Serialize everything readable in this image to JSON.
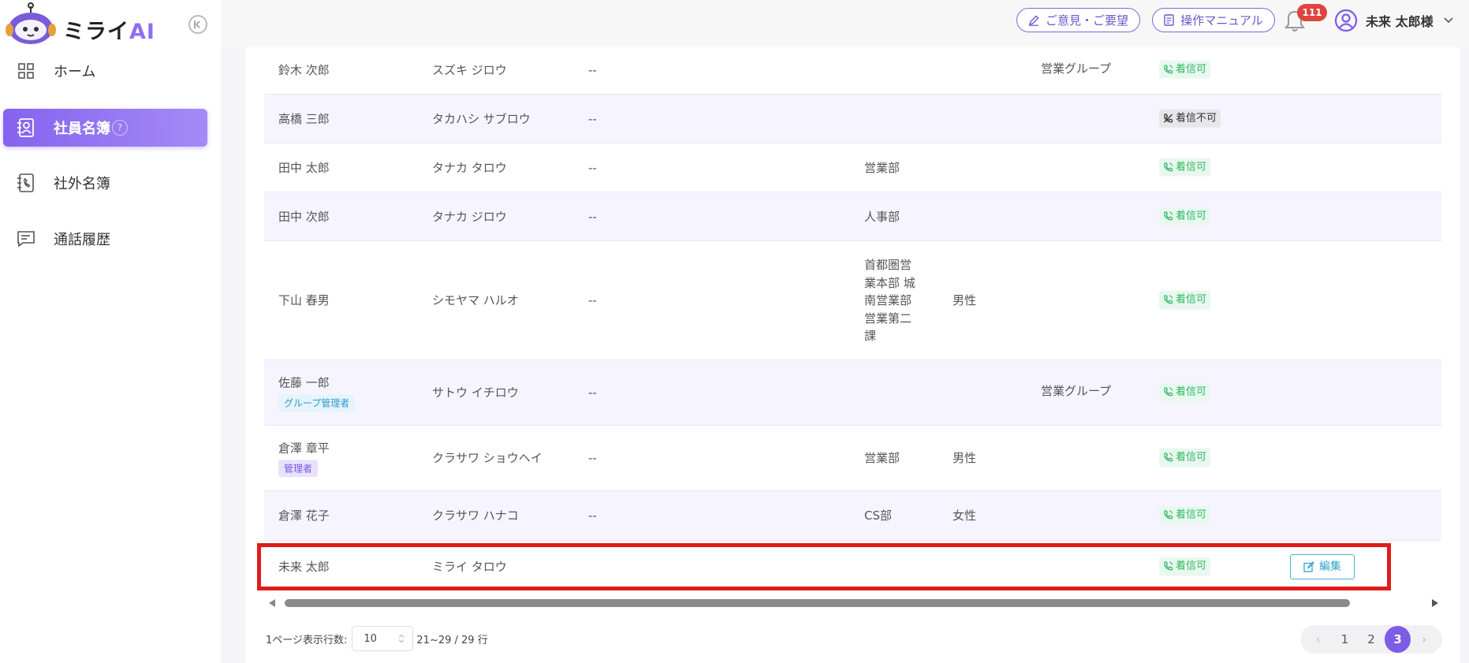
{
  "brand": {
    "name_part1": "ミライ",
    "name_part2": "AI"
  },
  "sidebar": {
    "items": [
      {
        "label": "ホーム",
        "icon": "grid-icon",
        "active": false
      },
      {
        "label": "社員名簿",
        "icon": "contact-book-icon",
        "active": true,
        "help": "?"
      },
      {
        "label": "社外名簿",
        "icon": "phone-book-icon",
        "active": false
      },
      {
        "label": "通話履歴",
        "icon": "chat-icon",
        "active": false
      }
    ]
  },
  "header": {
    "feedback_label": "ご意見・ご要望",
    "manual_label": "操作マニュアル",
    "notification_count": "111",
    "user_name": "未来  太郎様"
  },
  "table": {
    "rows": [
      {
        "name": "鈴木 次郎",
        "kana": "スズキ ジロウ",
        "tel": "--",
        "dept": "",
        "gender": "",
        "group": "営業グループ",
        "status": "着信可",
        "status_ok": true
      },
      {
        "name": "高橋 三郎",
        "kana": "タカハシ サブロウ",
        "tel": "--",
        "dept": "",
        "gender": "",
        "group": "",
        "status": "着信不可",
        "status_ok": false
      },
      {
        "name": "田中 太郎",
        "kana": "タナカ タロウ",
        "tel": "--",
        "dept": "営業部",
        "gender": "",
        "group": "",
        "status": "着信可",
        "status_ok": true
      },
      {
        "name": "田中 次郎",
        "kana": "タナカ ジロウ",
        "tel": "--",
        "dept": "人事部",
        "gender": "",
        "group": "",
        "status": "着信可",
        "status_ok": true
      },
      {
        "name": "下山 春男",
        "kana": "シモヤマ ハルオ",
        "tel": "--",
        "dept": "首都圏営業本部 城南営業部 営業第二課",
        "gender": "男性",
        "group": "",
        "status": "着信可",
        "status_ok": true
      },
      {
        "name": "佐藤 一郎",
        "role": "グループ管理者",
        "kana": "サトウ イチロウ",
        "tel": "--",
        "dept": "",
        "gender": "",
        "group": "営業グループ",
        "status": "着信可",
        "status_ok": true
      },
      {
        "name": "倉澤 章平",
        "role": "管理者",
        "kana": "クラサワ ショウヘイ",
        "tel": "--",
        "dept": "営業部",
        "gender": "男性",
        "group": "",
        "status": "着信可",
        "status_ok": true
      },
      {
        "name": "倉澤 花子",
        "kana": "クラサワ ハナコ",
        "tel": "--",
        "dept": "CS部",
        "gender": "女性",
        "group": "",
        "status": "着信可",
        "status_ok": true
      },
      {
        "name": "未来 太郎",
        "kana": "ミライ タロウ",
        "tel": "",
        "dept": "",
        "gender": "",
        "group": "",
        "status": "着信可",
        "status_ok": true,
        "action": "編集"
      }
    ]
  },
  "footer": {
    "page_size_label": "1ページ表示行数:",
    "page_size_value": "10",
    "range_label": "21~29 / 29 行",
    "pages": [
      "1",
      "2",
      "3"
    ],
    "current_page": "3",
    "prev": "‹",
    "next": "›"
  },
  "colors": {
    "accent": "#7d5ce6",
    "status_ok": "#2fb864",
    "highlight": "#e01c1c",
    "badge": "#e0443e"
  }
}
